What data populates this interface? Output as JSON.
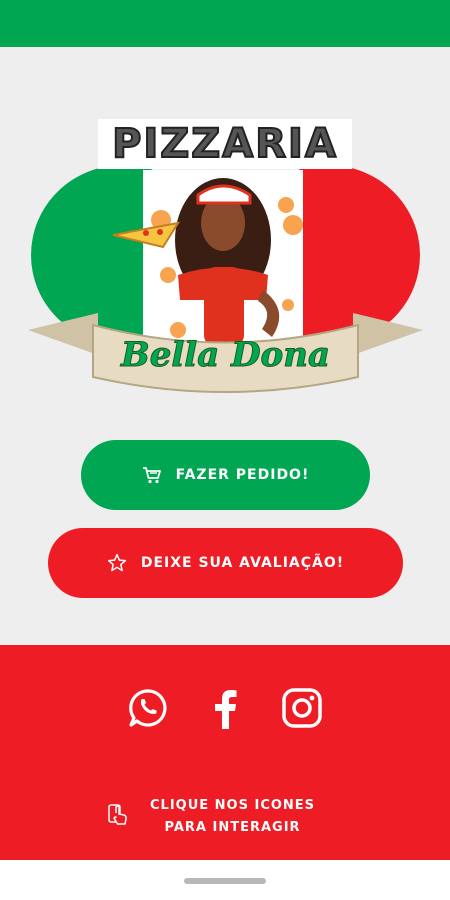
{
  "logo": {
    "title": "PIZZARIA",
    "script_name": "Bella Dona"
  },
  "buttons": {
    "order": {
      "label": "FAZER PEDIDO!",
      "icon": "cart-icon"
    },
    "review": {
      "label": "DEIXE SUA AVALIAÇÃO!",
      "icon": "star-icon"
    }
  },
  "footer": {
    "social": [
      "whatsapp-icon",
      "facebook-icon",
      "instagram-icon"
    ],
    "hint_line1": "CLIQUE NOS ICONES",
    "hint_line2": "PARA INTERAGIR"
  },
  "colors": {
    "green": "#00a651",
    "red": "#ee1c25",
    "background": "#eeeeee"
  }
}
